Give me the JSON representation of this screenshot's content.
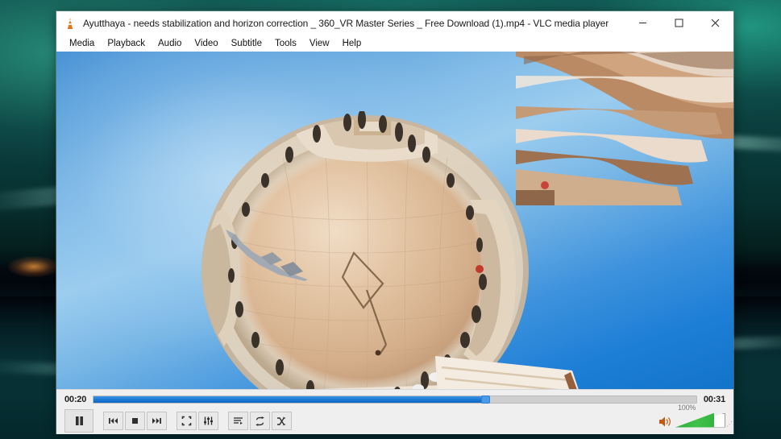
{
  "desktop": {
    "wallpaper_description": "aurora-night-landscape"
  },
  "window": {
    "app_icon": "vlc-cone-icon",
    "title": "Ayutthaya - needs stabilization and horizon correction _ 360_VR Master Series _ Free Download (1).mp4 - VLC media player",
    "controls": {
      "minimize": "minimize-icon",
      "maximize": "maximize-icon",
      "close": "close-icon"
    }
  },
  "menu": {
    "items": [
      {
        "label": "Media"
      },
      {
        "label": "Playback"
      },
      {
        "label": "Audio"
      },
      {
        "label": "Video"
      },
      {
        "label": "Subtitle"
      },
      {
        "label": "Tools"
      },
      {
        "label": "View"
      },
      {
        "label": "Help"
      }
    ]
  },
  "video": {
    "description": "360-degree tiny-planet stereographic projection of a stone plaza with buildings and people around the rim under a blue sky",
    "sky_color": "#4a93d6",
    "planet_color": "#d8b48c"
  },
  "playback": {
    "elapsed_time": "00:20",
    "total_time": "00:31",
    "progress_percent": 65,
    "seek_fill_color": "#1a76d2",
    "buttons": {
      "play_pause": {
        "label": "Pause",
        "icon": "pause-icon",
        "state": "playing"
      },
      "previous": {
        "label": "Previous",
        "icon": "previous-icon"
      },
      "stop": {
        "label": "Stop",
        "icon": "stop-icon"
      },
      "next": {
        "label": "Next",
        "icon": "next-icon"
      },
      "fullscreen": {
        "label": "Toggle fullscreen",
        "icon": "fullscreen-icon"
      },
      "extended_settings": {
        "label": "Show extended settings",
        "icon": "equalizer-icon"
      },
      "playlist": {
        "label": "Show playlist",
        "icon": "playlist-icon"
      },
      "loop": {
        "label": "Loop",
        "icon": "loop-icon"
      },
      "random": {
        "label": "Random",
        "icon": "shuffle-icon"
      }
    }
  },
  "volume": {
    "icon": "speaker-icon",
    "percent_label": "100%",
    "level": 100,
    "fill_color": "#35b440"
  }
}
